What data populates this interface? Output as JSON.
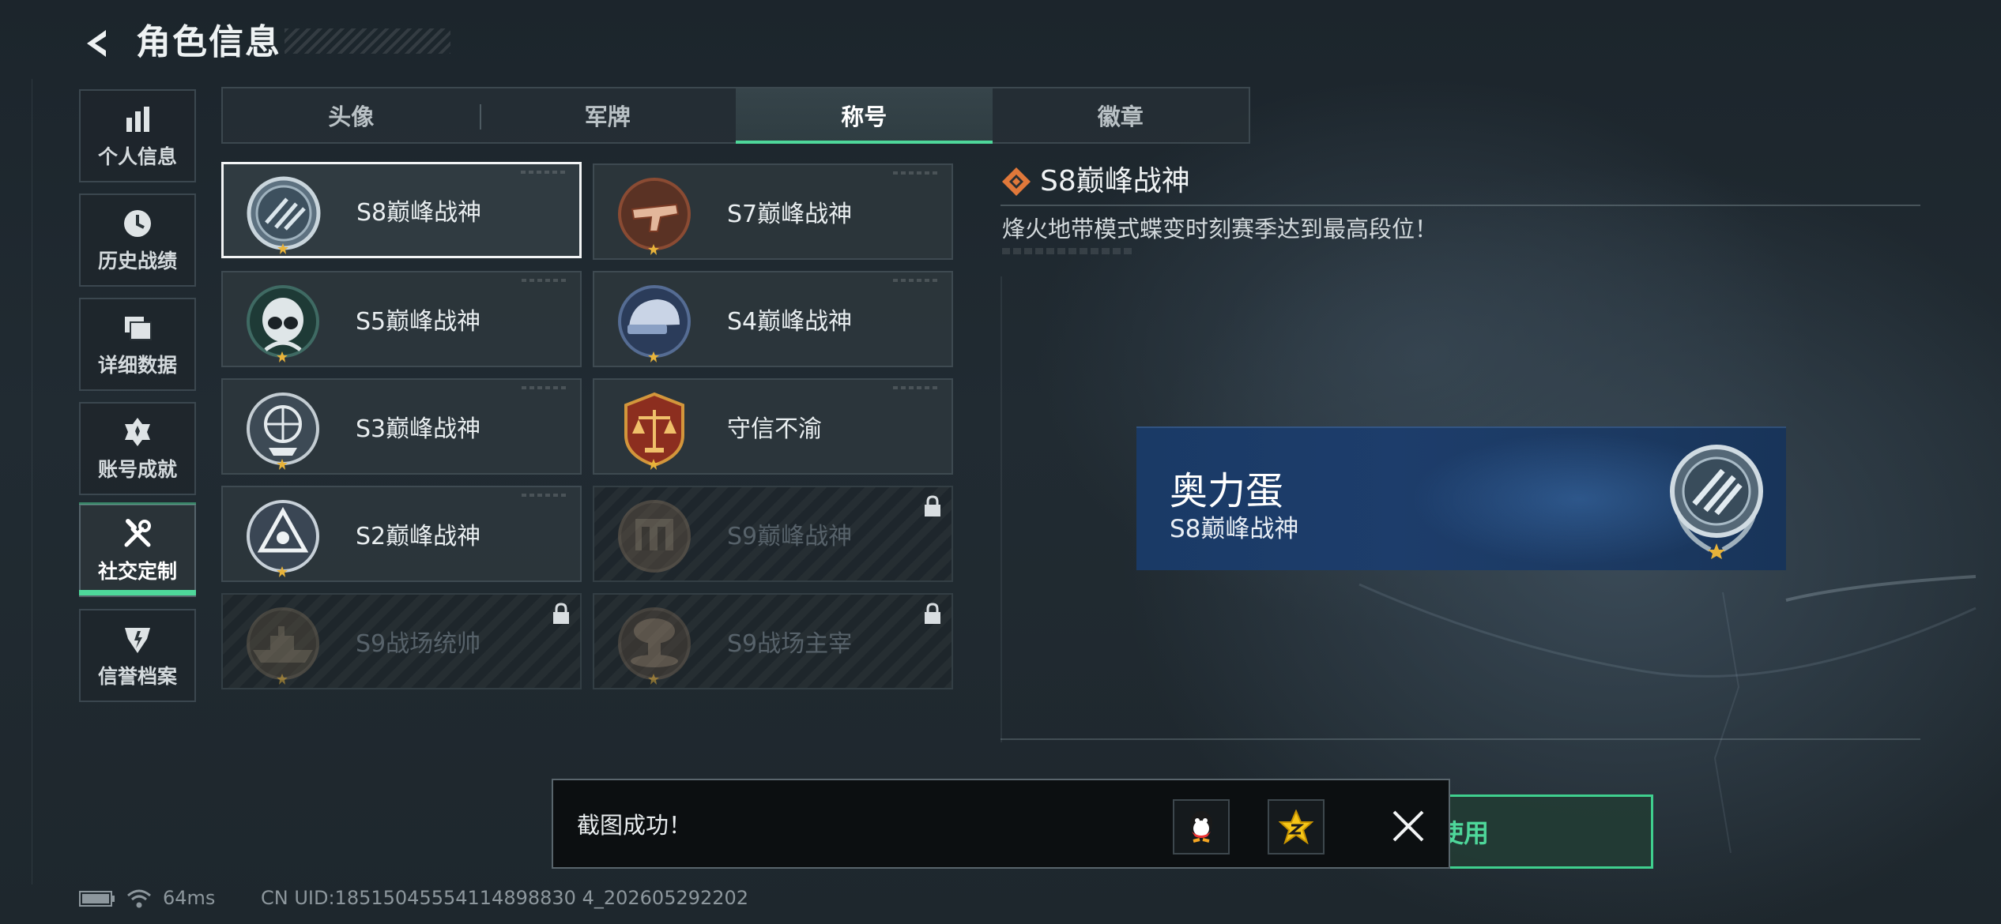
{
  "header": {
    "title": "角色信息"
  },
  "sidebar": {
    "items": [
      {
        "label": "个人信息",
        "icon": "bar-chart-icon"
      },
      {
        "label": "历史战绩",
        "icon": "clock-icon"
      },
      {
        "label": "详细数据",
        "icon": "folders-icon"
      },
      {
        "label": "账号成就",
        "icon": "medal-icon"
      },
      {
        "label": "社交定制",
        "icon": "tools-icon",
        "active": true
      },
      {
        "label": "信誉档案",
        "icon": "reputation-badge-icon"
      }
    ]
  },
  "tabs": [
    {
      "label": "头像"
    },
    {
      "label": "军牌"
    },
    {
      "label": "称号",
      "active": true
    },
    {
      "label": "徽章"
    }
  ],
  "titles": [
    {
      "label": "S8巅峰战神",
      "selected": true,
      "locked": false,
      "emblem": "s8-emblem"
    },
    {
      "label": "S7巅峰战神",
      "locked": false,
      "emblem": "s7-emblem"
    },
    {
      "label": "S5巅峰战神",
      "locked": false,
      "emblem": "s5-emblem"
    },
    {
      "label": "S4巅峰战神",
      "locked": false,
      "emblem": "s4-emblem"
    },
    {
      "label": "S3巅峰战神",
      "locked": false,
      "emblem": "s3-emblem"
    },
    {
      "label": "守信不渝",
      "locked": false,
      "emblem": "scales-emblem"
    },
    {
      "label": "S2巅峰战神",
      "locked": false,
      "emblem": "s2-emblem"
    },
    {
      "label": "S9巅峰战神",
      "locked": true,
      "emblem": "s9-emblem"
    },
    {
      "label": "S9战场统帅",
      "locked": true,
      "emblem": "warship-emblem"
    },
    {
      "label": "S9战场主宰",
      "locked": true,
      "emblem": "mushroom-cloud-emblem"
    }
  ],
  "detail": {
    "title": "S8巅峰战神",
    "description": "烽火地带模式蝶变时刻赛季达到最高段位！"
  },
  "nameplate": {
    "player_name": "奥力蛋",
    "title": "S8巅峰战神"
  },
  "equip_button": {
    "label": "使用"
  },
  "toast": {
    "message": "截图成功！",
    "share_targets": [
      "qq-icon",
      "qzone-icon"
    ],
    "close_icon": "close-icon"
  },
  "status_bar": {
    "ping": "64ms",
    "uid": "CN UID:18515045554114898830 4_202605292202"
  },
  "colors": {
    "accent_green": "#4ed79a",
    "nameplate_blue": "#1c3a63",
    "gold_star": "#e8b33a"
  }
}
